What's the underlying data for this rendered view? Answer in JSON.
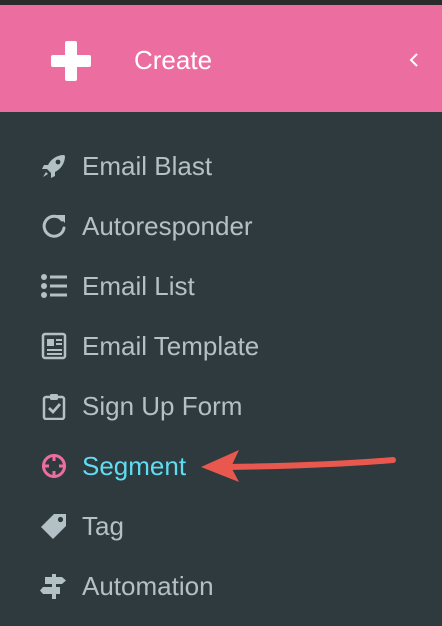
{
  "create": {
    "label": "Create",
    "icon": "plus-icon",
    "collapse_icon": "chevron-left-icon",
    "background": "#ec6ea0"
  },
  "menu": {
    "items": [
      {
        "label": "Email Blast",
        "icon": "rocket-icon"
      },
      {
        "label": "Autoresponder",
        "icon": "refresh-icon"
      },
      {
        "label": "Email List",
        "icon": "list-icon"
      },
      {
        "label": "Email Template",
        "icon": "template-icon"
      },
      {
        "label": "Sign Up Form",
        "icon": "clipboard-check-icon"
      },
      {
        "label": "Segment",
        "icon": "crosshair-icon",
        "active": true
      },
      {
        "label": "Tag",
        "icon": "tag-icon"
      },
      {
        "label": "Automation",
        "icon": "signpost-icon"
      }
    ]
  },
  "colors": {
    "sidebar_bg": "#2f3a3e",
    "text": "#b3c0c5",
    "active_text": "#5fdcf2",
    "active_icon": "#ec6ea0",
    "annotation_arrow": "#e8584e"
  }
}
